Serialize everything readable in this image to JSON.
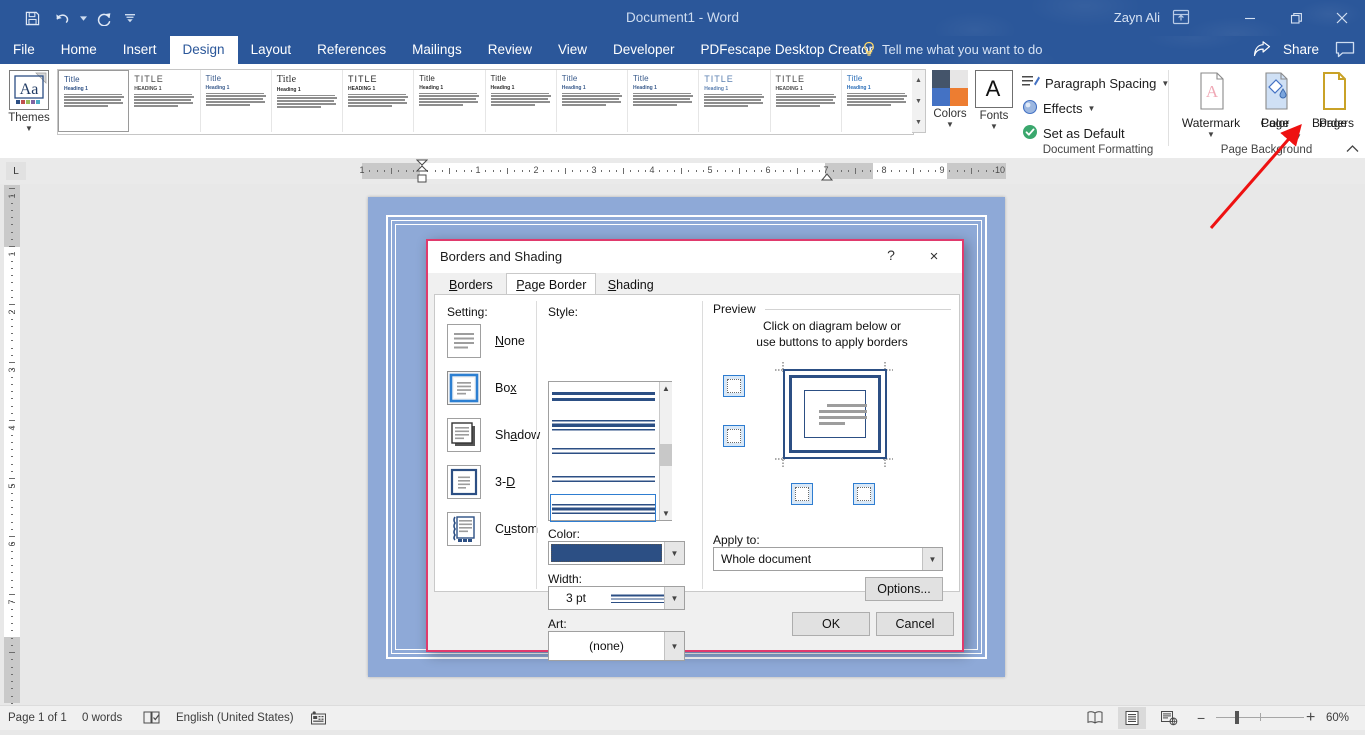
{
  "titlebar": {
    "document_title": "Document1  -  Word",
    "user_name": "Zayn Ali",
    "quick_access": [
      "save-icon",
      "undo-icon",
      "redo-icon",
      "customize-icon"
    ],
    "ribbon_display_options": "ribbon-display-options-icon",
    "minimize": "minimize-icon",
    "restore": "restore-icon",
    "close": "close-icon"
  },
  "tabs": [
    {
      "label": "File",
      "active": false
    },
    {
      "label": "Home",
      "active": false
    },
    {
      "label": "Insert",
      "active": false
    },
    {
      "label": "Design",
      "active": true
    },
    {
      "label": "Layout",
      "active": false
    },
    {
      "label": "References",
      "active": false
    },
    {
      "label": "Mailings",
      "active": false
    },
    {
      "label": "Review",
      "active": false
    },
    {
      "label": "View",
      "active": false
    },
    {
      "label": "Developer",
      "active": false
    },
    {
      "label": "PDFescape Desktop Creator",
      "active": false
    }
  ],
  "tellme": {
    "placeholder": "Tell me what you want to do",
    "icon": "lightbulb-icon"
  },
  "share": {
    "label": "Share",
    "icon": "share-icon",
    "comments_icon": "comment-icon"
  },
  "ribbon": {
    "groups": [
      {
        "label": "Document Formatting"
      },
      {
        "label": "Page Background"
      }
    ],
    "themes": {
      "label": "Themes",
      "icon": "themes-icon"
    },
    "gallery": [
      {
        "title": "Title",
        "heading": "Heading 1",
        "title_color": "#2c4f84",
        "title_style": "normal"
      },
      {
        "title": "TITLE",
        "heading": "HEADING 1",
        "title_color": "#4a4a4a",
        "title_style": "caps"
      },
      {
        "title": "Title",
        "heading": "Heading 1",
        "title_color": "#3a5b8c",
        "title_style": "bold"
      },
      {
        "title": "Title",
        "heading": "Heading 1",
        "title_color": "#2d2d2d",
        "title_style": "serif"
      },
      {
        "title": "TITLE",
        "heading": "HEADING 1",
        "title_color": "#2d2d2d",
        "title_style": "caps"
      },
      {
        "title": "Title",
        "heading": "Heading 1",
        "title_color": "#2d2d2d",
        "title_style": "normal"
      },
      {
        "title": "Title",
        "heading": "Heading 1",
        "title_color": "#2d2d2d",
        "title_style": "normal"
      },
      {
        "title": "Title",
        "heading": "Heading 1",
        "title_color": "#3a5b8c",
        "title_style": "normal"
      },
      {
        "title": "Title",
        "heading": "Heading 1",
        "title_color": "#3a5b8c",
        "title_style": "normal"
      },
      {
        "title": "TITLE",
        "heading": "Heading 1",
        "title_color": "#5a7fb0",
        "title_style": "spaced"
      },
      {
        "title": "TITLE",
        "heading": "HEADING 1",
        "title_color": "#4a4a4a",
        "title_style": "caps"
      },
      {
        "title": "Title",
        "heading": "Heading 1",
        "title_color": "#2c6fb8",
        "title_style": "normal"
      }
    ],
    "gallery_scroll": {
      "up": "scroll-up-icon",
      "down": "scroll-down-icon",
      "more": "more-styles-icon"
    },
    "colors": {
      "label": "Colors",
      "icon": "theme-colors-icon"
    },
    "fonts": {
      "label": "Fonts",
      "icon": "theme-fonts-icon"
    },
    "paragraph_spacing": {
      "label": "Paragraph Spacing",
      "icon": "paragraph-spacing-icon"
    },
    "effects": {
      "label": "Effects",
      "icon": "effects-icon"
    },
    "set_as_default": {
      "label": "Set as Default",
      "icon": "set-default-icon"
    },
    "watermark": {
      "label": "Watermark",
      "icon": "watermark-icon"
    },
    "page_color": {
      "label": "Page\nColor",
      "label_l1": "Page",
      "label_l2": "Color",
      "icon": "page-color-icon"
    },
    "page_borders": {
      "label_l1": "Page",
      "label_l2": "Borders",
      "icon": "page-borders-icon"
    },
    "collapse_ribbon": "collapse-ribbon-icon"
  },
  "ruler": {
    "tab_stop_marker": "L",
    "h_numbers": [
      "1",
      "1",
      "2",
      "3",
      "4",
      "5",
      "6",
      "7",
      "8",
      "9"
    ],
    "v_numbers": [
      "1",
      "1",
      "2",
      "3",
      "4",
      "5",
      "6",
      "7"
    ]
  },
  "dialog": {
    "title": "Borders and Shading",
    "help_button": "?",
    "close_button": "×",
    "tabs": [
      {
        "label": "Borders",
        "active": false
      },
      {
        "label": "Page Border",
        "active": true
      },
      {
        "label": "Shading",
        "active": false
      }
    ],
    "setting": {
      "label": "Setting:",
      "options": [
        {
          "label": "None",
          "selected": false,
          "icon": "setting-none-icon"
        },
        {
          "label": "Box",
          "selected": true,
          "icon": "setting-box-icon"
        },
        {
          "label": "Shadow",
          "selected": false,
          "icon": "setting-shadow-icon"
        },
        {
          "label": "3-D",
          "selected": false,
          "icon": "setting-3d-icon"
        },
        {
          "label": "Custom",
          "selected": false,
          "icon": "setting-custom-icon"
        }
      ]
    },
    "style": {
      "label": "Style:",
      "items": [
        {
          "kind": "double-thick-thin",
          "selected": false
        },
        {
          "kind": "triple-line",
          "selected": false
        },
        {
          "kind": "thin-thick-thin",
          "selected": false
        },
        {
          "kind": "thin-double",
          "selected": false
        },
        {
          "kind": "triple-mixed",
          "selected": true
        }
      ],
      "scrollbar": {
        "up": "scroll-up-icon",
        "down": "scroll-down-icon"
      }
    },
    "color": {
      "label": "Color:",
      "value_hex": "#2c4f84",
      "dropdown": "chevron-down-icon"
    },
    "width": {
      "label": "Width:",
      "value": "3 pt",
      "dropdown": "chevron-down-icon"
    },
    "art": {
      "label": "Art:",
      "value": "(none)",
      "dropdown": "chevron-down-icon"
    },
    "preview": {
      "legend": "Preview",
      "instruction_line1": "Click on diagram below or",
      "instruction_line2": "use buttons to apply borders",
      "buttons": [
        {
          "name": "top-border-button"
        },
        {
          "name": "bottom-border-button"
        },
        {
          "name": "left-border-button"
        },
        {
          "name": "right-border-button"
        }
      ]
    },
    "apply_to": {
      "label": "Apply to:",
      "value": "Whole document",
      "dropdown": "chevron-down-icon"
    },
    "options_button": "Options...",
    "ok_button": "OK",
    "cancel_button": "Cancel"
  },
  "statusbar": {
    "page": "Page 1 of 1",
    "words": "0 words",
    "proofing_icon": "proofing-icon",
    "language": "English (United States)",
    "macro_icon": "macro-record-icon",
    "views": [
      {
        "name": "read-mode-icon",
        "active": false
      },
      {
        "name": "print-layout-icon",
        "active": true
      },
      {
        "name": "web-layout-icon",
        "active": false
      }
    ],
    "zoom_out": "−",
    "zoom_in": "+",
    "zoom_level": "60%"
  },
  "annotation": {
    "arrow_color": "#ee1111",
    "target": "page-borders-button"
  }
}
